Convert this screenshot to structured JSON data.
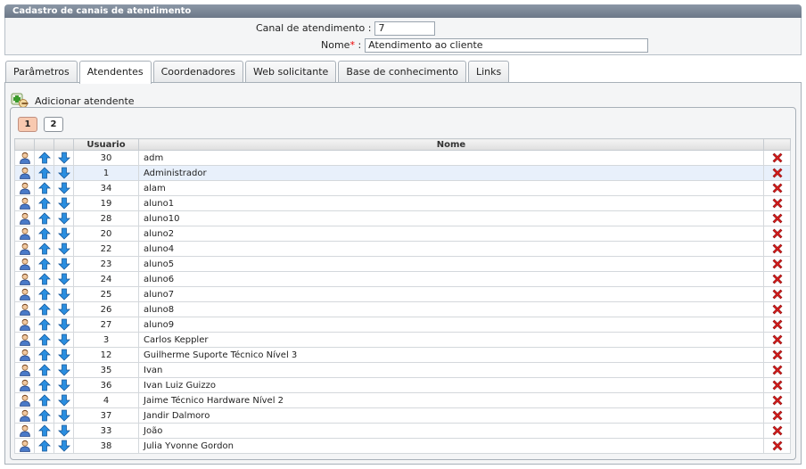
{
  "panel": {
    "title": "Cadastro de canais de atendimento"
  },
  "form": {
    "channel_label": "Canal de atendimento :",
    "channel_value": "7",
    "name_label": "Nome",
    "name_required": "*",
    "name_colon": " :",
    "name_value": "Atendimento ao cliente"
  },
  "tabs": [
    {
      "label": "Parâmetros",
      "active": false
    },
    {
      "label": "Atendentes",
      "active": true
    },
    {
      "label": "Coordenadores",
      "active": false
    },
    {
      "label": "Web solicitante",
      "active": false
    },
    {
      "label": "Base de conhecimento",
      "active": false
    },
    {
      "label": "Links",
      "active": false
    }
  ],
  "toolbar": {
    "add_label": "Adicionar atendente"
  },
  "pager": {
    "pages": [
      "1",
      "2"
    ],
    "current": "1"
  },
  "table": {
    "columns": {
      "user": "Usuario",
      "name": "Nome"
    },
    "rows": [
      {
        "user": "30",
        "name": "adm"
      },
      {
        "user": "1",
        "name": "Administrador",
        "selected": true
      },
      {
        "user": "34",
        "name": "alam"
      },
      {
        "user": "19",
        "name": "aluno1"
      },
      {
        "user": "28",
        "name": "aluno10"
      },
      {
        "user": "20",
        "name": "aluno2"
      },
      {
        "user": "22",
        "name": "aluno4"
      },
      {
        "user": "23",
        "name": "aluno5"
      },
      {
        "user": "24",
        "name": "aluno6"
      },
      {
        "user": "25",
        "name": "aluno7"
      },
      {
        "user": "26",
        "name": "aluno8"
      },
      {
        "user": "27",
        "name": "aluno9"
      },
      {
        "user": "3",
        "name": "Carlos Keppler"
      },
      {
        "user": "12",
        "name": "Guilherme Suporte Técnico Nível 3"
      },
      {
        "user": "35",
        "name": "Ivan"
      },
      {
        "user": "36",
        "name": "Ivan Luiz Guizzo"
      },
      {
        "user": "4",
        "name": "Jaime Técnico Hardware Nível 2"
      },
      {
        "user": "37",
        "name": "Jandir Dalmoro"
      },
      {
        "user": "33",
        "name": "João"
      },
      {
        "user": "38",
        "name": "Julia Yvonne Gordon"
      }
    ]
  },
  "colors": {
    "header": "#7a8696",
    "selected_row": "#e8f0fb",
    "active_page": "#f8c9b0",
    "arrow": "#2a8ee0",
    "delete": "#d81e1e"
  },
  "icons": {
    "user": "user-icon",
    "up": "arrow-up-icon",
    "down": "arrow-down-icon",
    "delete": "delete-icon",
    "add": "add-user-icon"
  }
}
